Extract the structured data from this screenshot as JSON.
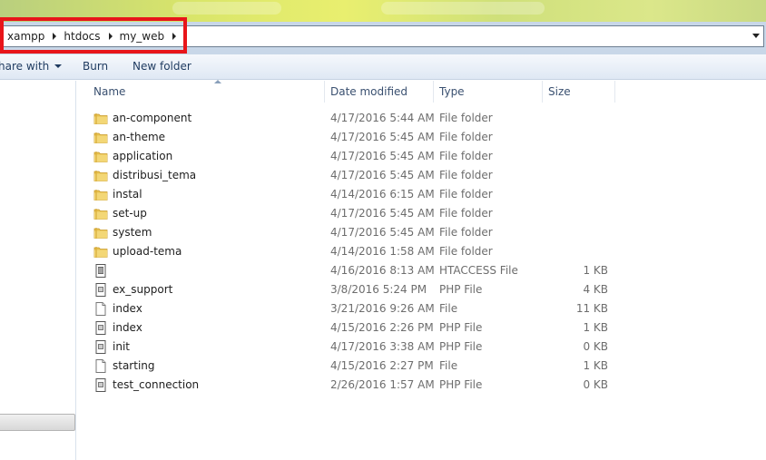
{
  "address_bar": {
    "crumbs": [
      "xampp",
      "htdocs",
      "my_web"
    ]
  },
  "toolbar": {
    "share_label": "hare with",
    "burn_label": "Burn",
    "new_folder_label": "New folder"
  },
  "columns": {
    "name": "Name",
    "date": "Date modified",
    "type": "Type",
    "size": "Size"
  },
  "files": [
    {
      "name": "an-component",
      "date": "4/17/2016 5:44 AM",
      "type": "File folder",
      "size": "",
      "icon": "folder-icon"
    },
    {
      "name": "an-theme",
      "date": "4/17/2016 5:45 AM",
      "type": "File folder",
      "size": "",
      "icon": "folder-icon"
    },
    {
      "name": "application",
      "date": "4/17/2016 5:45 AM",
      "type": "File folder",
      "size": "",
      "icon": "folder-icon"
    },
    {
      "name": "distribusi_tema",
      "date": "4/17/2016 5:45 AM",
      "type": "File folder",
      "size": "",
      "icon": "folder-icon"
    },
    {
      "name": "instal",
      "date": "4/14/2016 6:15 AM",
      "type": "File folder",
      "size": "",
      "icon": "folder-icon"
    },
    {
      "name": "set-up",
      "date": "4/17/2016 5:45 AM",
      "type": "File folder",
      "size": "",
      "icon": "folder-icon"
    },
    {
      "name": "system",
      "date": "4/17/2016 5:45 AM",
      "type": "File folder",
      "size": "",
      "icon": "folder-icon"
    },
    {
      "name": "upload-tema",
      "date": "4/14/2016 1:58 AM",
      "type": "File folder",
      "size": "",
      "icon": "folder-icon"
    },
    {
      "name": "",
      "date": "4/16/2016 8:13 AM",
      "type": "HTACCESS File",
      "size": "1 KB",
      "icon": "config-file-icon"
    },
    {
      "name": "ex_support",
      "date": "3/8/2016 5:24 PM",
      "type": "PHP File",
      "size": "4 KB",
      "icon": "php-file-icon"
    },
    {
      "name": "index",
      "date": "3/21/2016 9:26 AM",
      "type": "File",
      "size": "11 KB",
      "icon": "blank-file-icon"
    },
    {
      "name": "index",
      "date": "4/15/2016 2:26 PM",
      "type": "PHP File",
      "size": "1 KB",
      "icon": "php-file-icon"
    },
    {
      "name": "init",
      "date": "4/17/2016 3:38 AM",
      "type": "PHP File",
      "size": "0 KB",
      "icon": "php-file-icon"
    },
    {
      "name": "starting",
      "date": "4/15/2016 2:27 PM",
      "type": "File",
      "size": "1 KB",
      "icon": "blank-file-icon"
    },
    {
      "name": "test_connection",
      "date": "2/26/2016 1:57 AM",
      "type": "PHP File",
      "size": "0 KB",
      "icon": "php-file-icon"
    }
  ],
  "colors": {
    "highlight": "#e8151a",
    "folder": "#e8c352"
  }
}
